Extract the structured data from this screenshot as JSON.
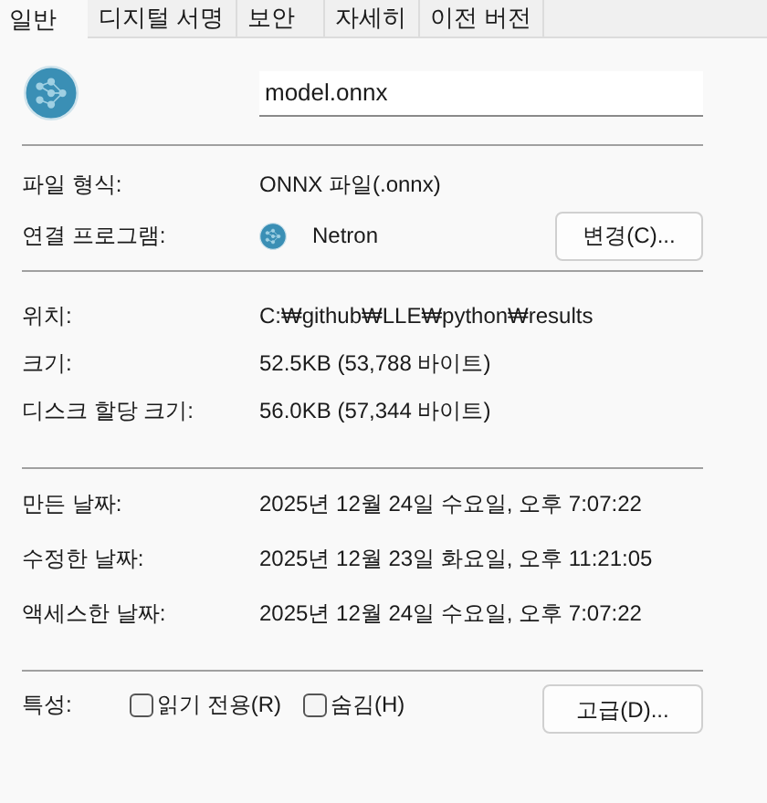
{
  "tabs": [
    {
      "label": "일반",
      "selected": true
    },
    {
      "label": "디지털 서명",
      "selected": false
    },
    {
      "label": "보안",
      "selected": false
    },
    {
      "label": "자세히",
      "selected": false
    },
    {
      "label": "이전 버전",
      "selected": false
    }
  ],
  "file_name": {
    "value": "model.onnx"
  },
  "type_row": {
    "label": "파일 형식:",
    "value": "ONNX 파일(.onnx)"
  },
  "opens_with": {
    "label": "연결 프로그램:",
    "app": "Netron",
    "button": "변경(C)..."
  },
  "location_rows": [
    {
      "label": "위치:",
      "value": "C:₩github₩LLE₩python₩results"
    },
    {
      "label": "크기:",
      "value": "52.5KB (53,788 바이트)"
    },
    {
      "label": "디스크 할당 크기:",
      "value": "56.0KB (57,344 바이트)"
    }
  ],
  "date_rows": [
    {
      "label": "만든 날짜:",
      "value": "2025년 12월 24일 수요일, 오후 7:07:22"
    },
    {
      "label": "수정한 날짜:",
      "value": "2025년 12월 23일 화요일, 오후 11:21:05"
    },
    {
      "label": "액세스한 날짜:",
      "value": "2025년 12월 24일 수요일, 오후 7:07:22"
    }
  ],
  "attributes": {
    "label": "특성:",
    "checkboxes": [
      {
        "label": "읽기 전용(R)",
        "checked": false
      },
      {
        "label": "숨김(H)",
        "checked": false
      }
    ],
    "button": "고급(D)..."
  }
}
